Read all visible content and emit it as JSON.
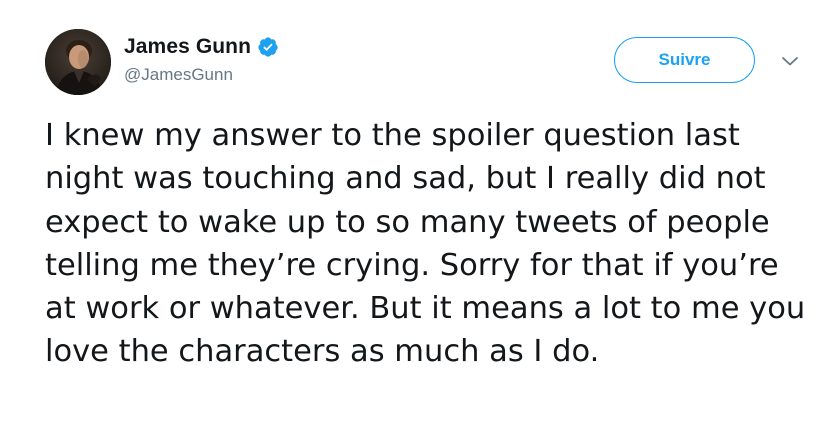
{
  "author": {
    "display_name": "James Gunn",
    "handle": "@JamesGunn",
    "verified": true,
    "avatar_icon": "profile-photo"
  },
  "actions": {
    "follow_label": "Suivre",
    "menu_icon": "chevron-down-icon"
  },
  "tweet": {
    "text": "I knew my answer to the spoiler question last night was touching and sad, but I really did not expect to wake up to so many tweets of people telling me they’re crying. Sorry for that if you’re at work or whatever. But it means a lot to me you love the characters as much as I do."
  },
  "colors": {
    "accent": "#1da1f2",
    "text_primary": "#14171a",
    "text_secondary": "#657786"
  }
}
